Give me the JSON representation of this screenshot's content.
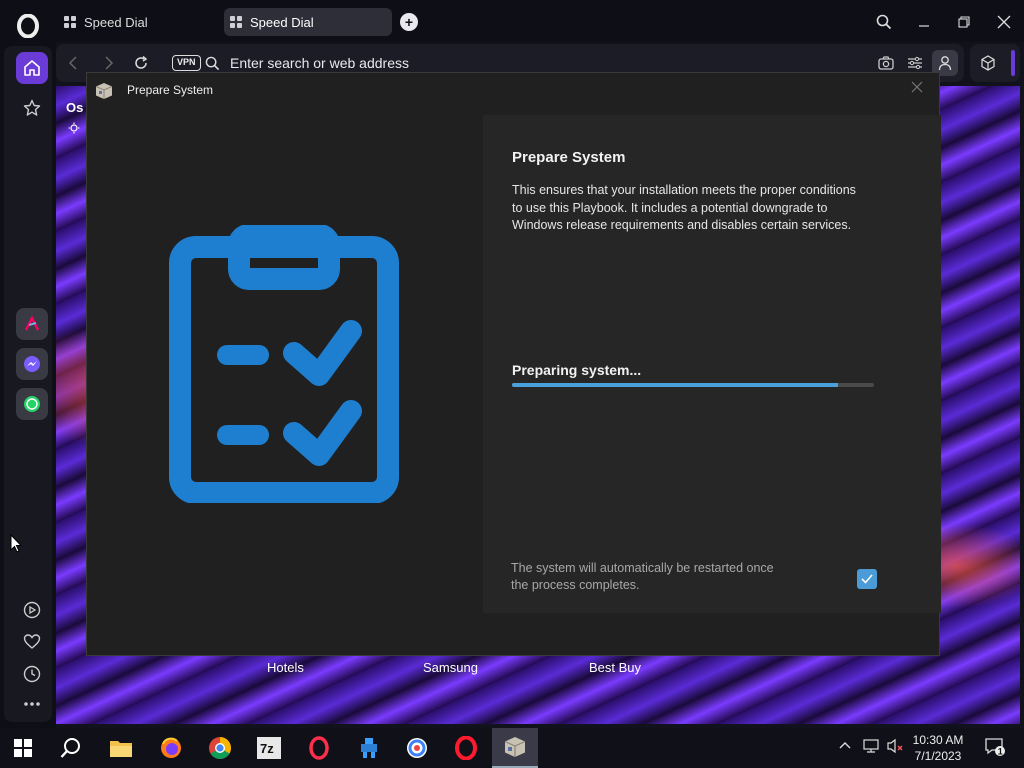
{
  "browser": {
    "tabs": [
      {
        "label": "Speed Dial"
      },
      {
        "label": "Speed Dial"
      }
    ],
    "address_placeholder": "Enter search or web address",
    "vpn_label": "VPN"
  },
  "speed_dial": {
    "partial_label": "Os",
    "tiles": [
      "Hotels",
      "Samsung",
      "Best Buy"
    ]
  },
  "dialog": {
    "window_title": "Prepare System",
    "heading": "Prepare System",
    "description": "This ensures that your installation meets the proper conditions to use this Playbook. It includes a potential downgrade to Windows release requirements and disables certain services.",
    "status": "Preparing system...",
    "progress": 0.9,
    "restart_note": "The system will automatically be restarted once the process completes.",
    "restart_checked": true,
    "accent_color": "#4aa0dc",
    "icon": "clipboard-checklist-icon"
  },
  "taskbar": {
    "apps": [
      "start",
      "search",
      "file-explorer",
      "firefox",
      "chrome",
      "7zip",
      "opera-gx",
      "pixel-app",
      "brave",
      "opera",
      "playbook-installer"
    ],
    "time": "10:30 AM",
    "date": "7/1/2023",
    "notifications": "1"
  }
}
